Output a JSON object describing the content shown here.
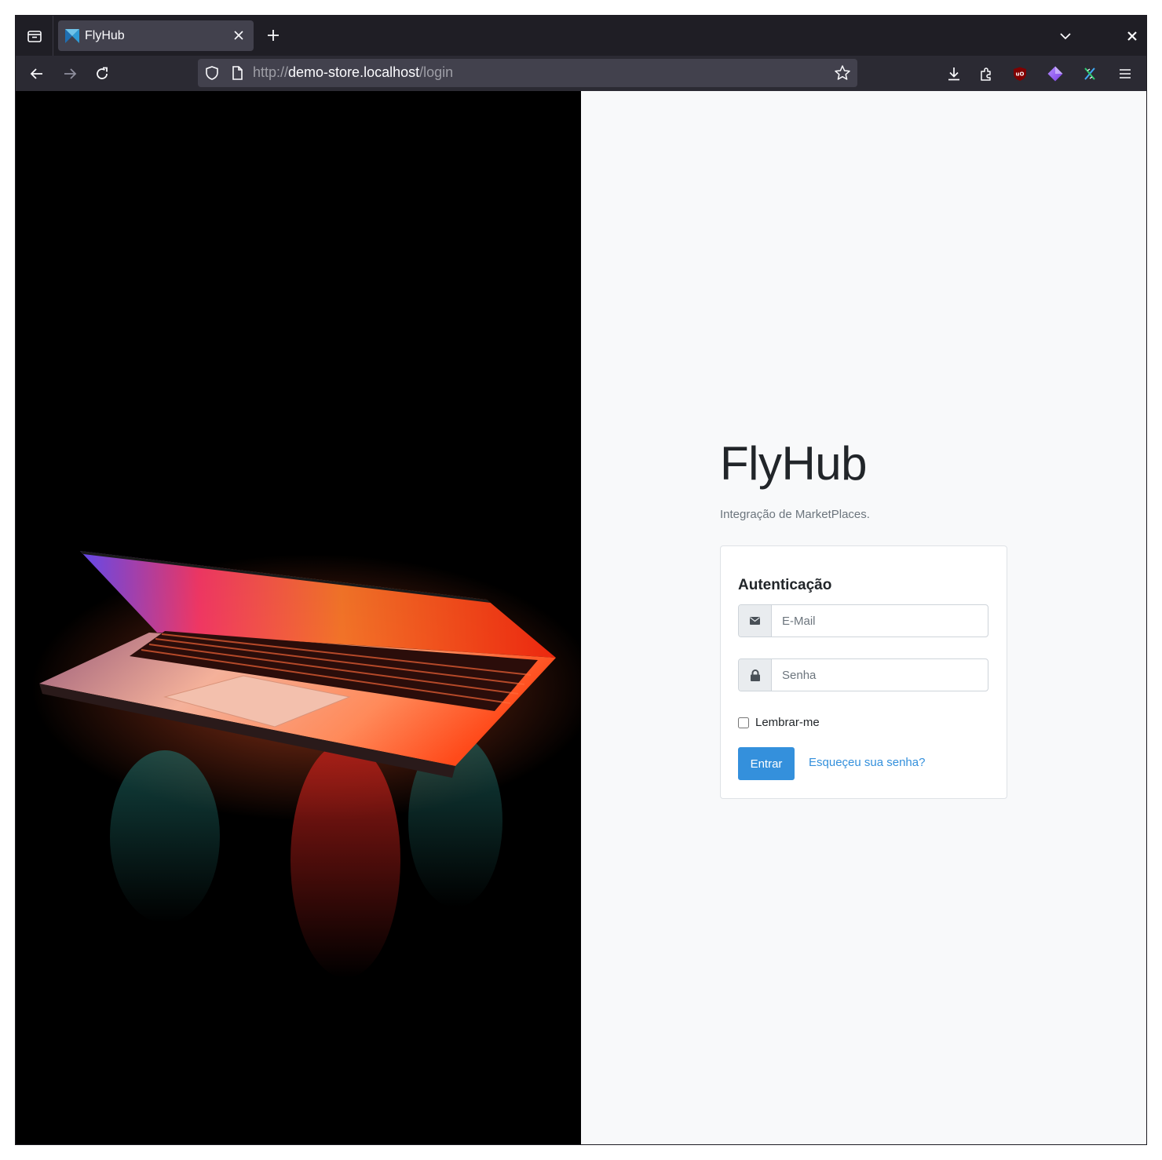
{
  "browser": {
    "tab": {
      "title": "FlyHub",
      "favicon": "flyhub-logo"
    },
    "url": {
      "scheme": "http://",
      "host": "demo-store.localhost",
      "path": "/login"
    },
    "colors": {
      "chrome": "#1f1e25",
      "toolbar": "#2b2a33",
      "urlbar": "#42414d"
    }
  },
  "page": {
    "hero_image": "laptop-glowing-keyboard-dark-background",
    "brand": "FlyHub",
    "tagline": "Integração de MarketPlaces.",
    "card": {
      "title": "Autenticação",
      "email_placeholder": "E-Mail",
      "email_icon": "envelope-icon",
      "password_placeholder": "Senha",
      "password_icon": "lock-icon",
      "remember_label": "Lembrar-me",
      "remember_checked": false,
      "submit_label": "Entrar",
      "forgot_label": "Esqueçeu sua senha?"
    },
    "colors": {
      "background": "#f8f9fa",
      "primary": "#3490dc",
      "text": "#212529",
      "muted": "#6c757d"
    }
  }
}
